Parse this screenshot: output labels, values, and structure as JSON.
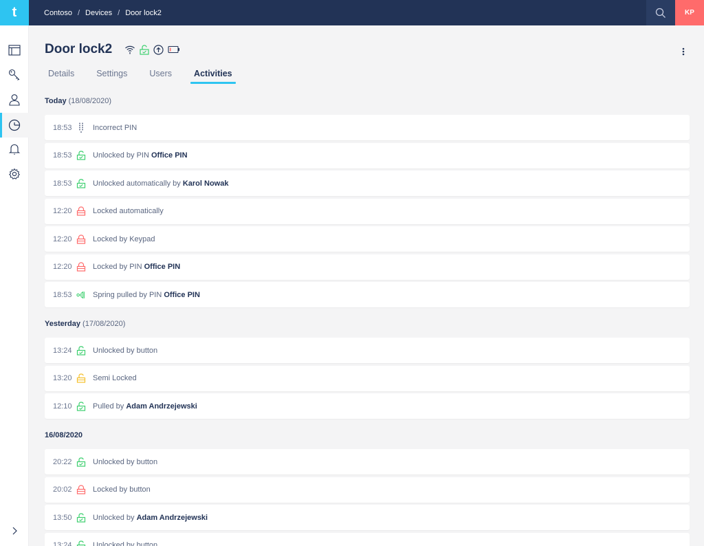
{
  "app": {
    "logo_letter": "t"
  },
  "breadcrumb": [
    "Contoso",
    "Devices",
    "Door lock2"
  ],
  "user": {
    "initials": "KP"
  },
  "colors": {
    "accent": "#2ec4f1",
    "navy": "#223356",
    "unlocked": "#3ccf6e",
    "locked": "#ff6b6b",
    "semi": "#f5c02b",
    "avatar": "#ff6b6b"
  },
  "sidebar": {
    "items": [
      {
        "name": "dashboard",
        "icon": "layout-icon"
      },
      {
        "name": "keys",
        "icon": "key-icon"
      },
      {
        "name": "users",
        "icon": "user-icon"
      },
      {
        "name": "activity",
        "icon": "pie-icon",
        "active": true
      },
      {
        "name": "notifications",
        "icon": "bell-icon"
      },
      {
        "name": "settings",
        "icon": "gear-icon"
      }
    ]
  },
  "device": {
    "title": "Door lock2",
    "status_icons": [
      "wifi-icon",
      "unlocked-icon",
      "upload-icon",
      "battery-low-icon"
    ]
  },
  "tabs": [
    {
      "label": "Details"
    },
    {
      "label": "Settings"
    },
    {
      "label": "Users"
    },
    {
      "label": "Activities",
      "active": true
    }
  ],
  "groups": [
    {
      "label": "Today",
      "date": "(18/08/2020)",
      "events": [
        {
          "time": "18:53",
          "icon": "keypad",
          "text": "Incorrect PIN",
          "bold": ""
        },
        {
          "time": "18:53",
          "icon": "unlocked",
          "text": "Unlocked by PIN ",
          "bold": "Office PIN"
        },
        {
          "time": "18:53",
          "icon": "unlocked",
          "text": "Unlocked automatically by ",
          "bold": "Karol Nowak"
        },
        {
          "time": "12:20",
          "icon": "locked",
          "text": "Locked automatically",
          "bold": ""
        },
        {
          "time": "12:20",
          "icon": "locked",
          "text": "Locked by Keypad",
          "bold": ""
        },
        {
          "time": "12:20",
          "icon": "locked",
          "text": "Locked by PIN ",
          "bold": "Office PIN"
        },
        {
          "time": "18:53",
          "icon": "spring",
          "text": "Spring pulled by PIN ",
          "bold": "Office PIN"
        }
      ]
    },
    {
      "label": "Yesterday",
      "date": "(17/08/2020)",
      "events": [
        {
          "time": "13:24",
          "icon": "unlocked",
          "text": "Unlocked by button",
          "bold": ""
        },
        {
          "time": "13:20",
          "icon": "semi",
          "text": "Semi Locked",
          "bold": ""
        },
        {
          "time": "12:10",
          "icon": "unlocked",
          "text": "Pulled by ",
          "bold": "Adam Andrzejewski"
        }
      ]
    },
    {
      "label": "16/08/2020",
      "date": "",
      "events": [
        {
          "time": "20:22",
          "icon": "unlocked",
          "text": "Unlocked by button",
          "bold": ""
        },
        {
          "time": "20:02",
          "icon": "locked",
          "text": "Locked by button",
          "bold": ""
        },
        {
          "time": "13:50",
          "icon": "unlocked",
          "text": "Unlocked by ",
          "bold": "Adam Andrzejewski"
        },
        {
          "time": "13:24",
          "icon": "unlocked",
          "text": "Unlocked by button",
          "bold": ""
        }
      ]
    }
  ]
}
